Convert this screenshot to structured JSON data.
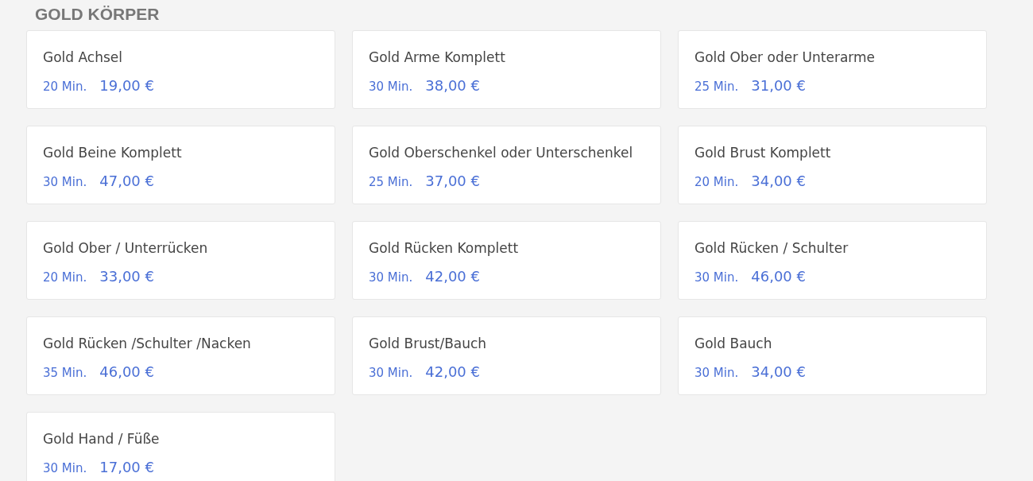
{
  "section_title": "GOLD KÖRPER",
  "services": [
    {
      "name": "Gold Achsel",
      "duration": "20 Min.",
      "price": "19,00 €"
    },
    {
      "name": "Gold Arme Komplett",
      "duration": "30 Min.",
      "price": "38,00 €"
    },
    {
      "name": "Gold Ober oder Unterarme",
      "duration": "25 Min.",
      "price": "31,00 €"
    },
    {
      "name": "Gold Beine Komplett",
      "duration": "30 Min.",
      "price": "47,00 €"
    },
    {
      "name": "Gold Oberschenkel oder Unterschenkel",
      "duration": "25 Min.",
      "price": "37,00 €"
    },
    {
      "name": "Gold Brust Komplett",
      "duration": "20 Min.",
      "price": "34,00 €"
    },
    {
      "name": "Gold Ober / Unterrücken",
      "duration": "20 Min.",
      "price": "33,00 €"
    },
    {
      "name": "Gold Rücken Komplett",
      "duration": "30 Min.",
      "price": "42,00 €"
    },
    {
      "name": "Gold Rücken / Schulter",
      "duration": "30 Min.",
      "price": "46,00 €"
    },
    {
      "name": "Gold Rücken /Schulter /Nacken",
      "duration": "35 Min.",
      "price": "46,00 €"
    },
    {
      "name": "Gold Brust/Bauch",
      "duration": "30 Min.",
      "price": "42,00 €"
    },
    {
      "name": "Gold Bauch",
      "duration": "30 Min.",
      "price": "34,00 €"
    },
    {
      "name": "Gold Hand / Füße",
      "duration": "30 Min.",
      "price": "17,00 €"
    }
  ]
}
